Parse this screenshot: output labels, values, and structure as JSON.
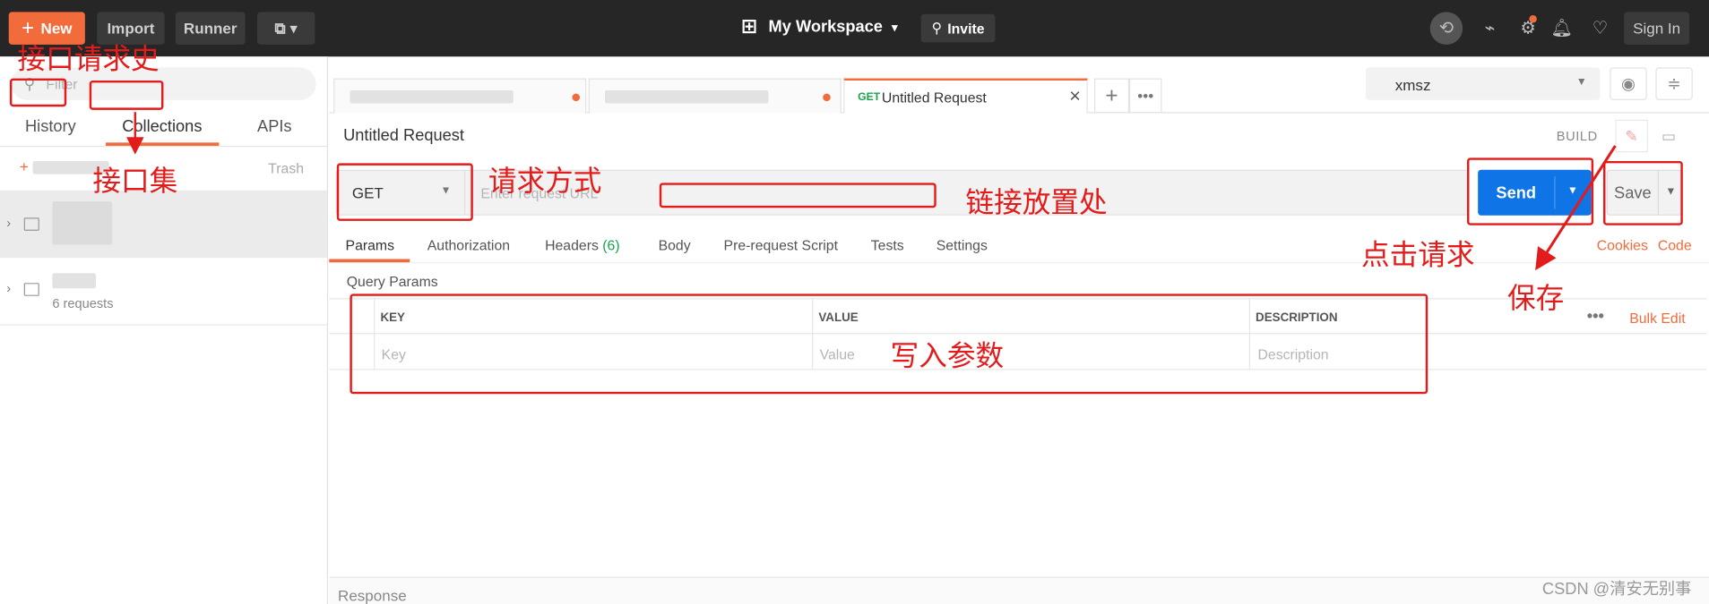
{
  "topbar": {
    "new_label": "New",
    "import_label": "Import",
    "runner_label": "Runner",
    "workspace": "My Workspace",
    "invite_label": "Invite",
    "signin_label": "Sign In"
  },
  "sidebar": {
    "filter_placeholder": "Filter",
    "tabs": [
      "History",
      "Collections",
      "APIs"
    ],
    "active_tab": "Collections",
    "trash_label": "Trash",
    "collection2_count": "6 requests"
  },
  "request_tabs": [
    {
      "method": "GET",
      "title": "Untitled Request",
      "active": true
    }
  ],
  "environment": {
    "selected": "xmsz"
  },
  "request": {
    "name": "Untitled Request",
    "build_label": "BUILD",
    "method": "GET",
    "url_placeholder": "Enter request URL",
    "send_label": "Send",
    "save_label": "Save"
  },
  "sub_tabs": [
    {
      "label": "Params",
      "active": true
    },
    {
      "label": "Authorization"
    },
    {
      "label": "Headers",
      "count": "(6)"
    },
    {
      "label": "Body"
    },
    {
      "label": "Pre-request Script"
    },
    {
      "label": "Tests"
    },
    {
      "label": "Settings"
    }
  ],
  "links": {
    "cookies": "Cookies",
    "code": "Code"
  },
  "params": {
    "title": "Query Params",
    "headers": [
      "KEY",
      "VALUE",
      "DESCRIPTION"
    ],
    "placeholders": [
      "Key",
      "Value",
      "Description"
    ],
    "bulk_edit": "Bulk Edit"
  },
  "response_label": "Response",
  "annotations": {
    "history_api": "接口请求史",
    "collections": "接口集",
    "method": "请求方式",
    "url": "链接放置处",
    "send": "点击请求",
    "save": "保存",
    "params": "写入参数"
  },
  "watermark": "CSDN @清安无别事",
  "colors": {
    "accent": "#f26b3a",
    "send": "#0f74e6",
    "annotation": "#e31b1b",
    "topbar": "#262626"
  }
}
